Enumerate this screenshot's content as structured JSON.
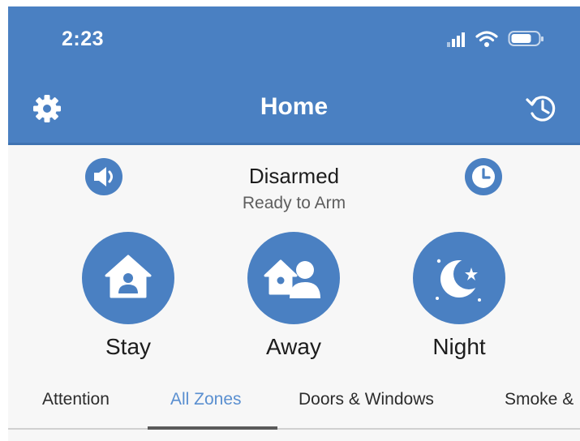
{
  "status_bar": {
    "time": "2:23",
    "icons": [
      "cellular-signal-icon",
      "wifi-icon",
      "battery-icon"
    ]
  },
  "nav": {
    "title": "Home",
    "left_icon": "gear-icon",
    "right_icon": "history-icon"
  },
  "alarm": {
    "state": "Disarmed",
    "substate": "Ready to Arm",
    "left_icon": "speaker-icon",
    "right_icon": "clock-icon"
  },
  "modes": [
    {
      "label": "Stay",
      "icon": "house-person-icon"
    },
    {
      "label": "Away",
      "icon": "house-people-icon"
    },
    {
      "label": "Night",
      "icon": "moon-stars-icon"
    }
  ],
  "tabs": [
    {
      "label": "Attention",
      "active": false
    },
    {
      "label": "All Zones",
      "active": true
    },
    {
      "label": "Doors & Windows",
      "active": false
    },
    {
      "label": "Smoke &",
      "active": false
    }
  ],
  "colors": {
    "brand_blue": "#4a80c2",
    "active_tab": "#5a8fd0",
    "background": "#f7f7f7"
  }
}
